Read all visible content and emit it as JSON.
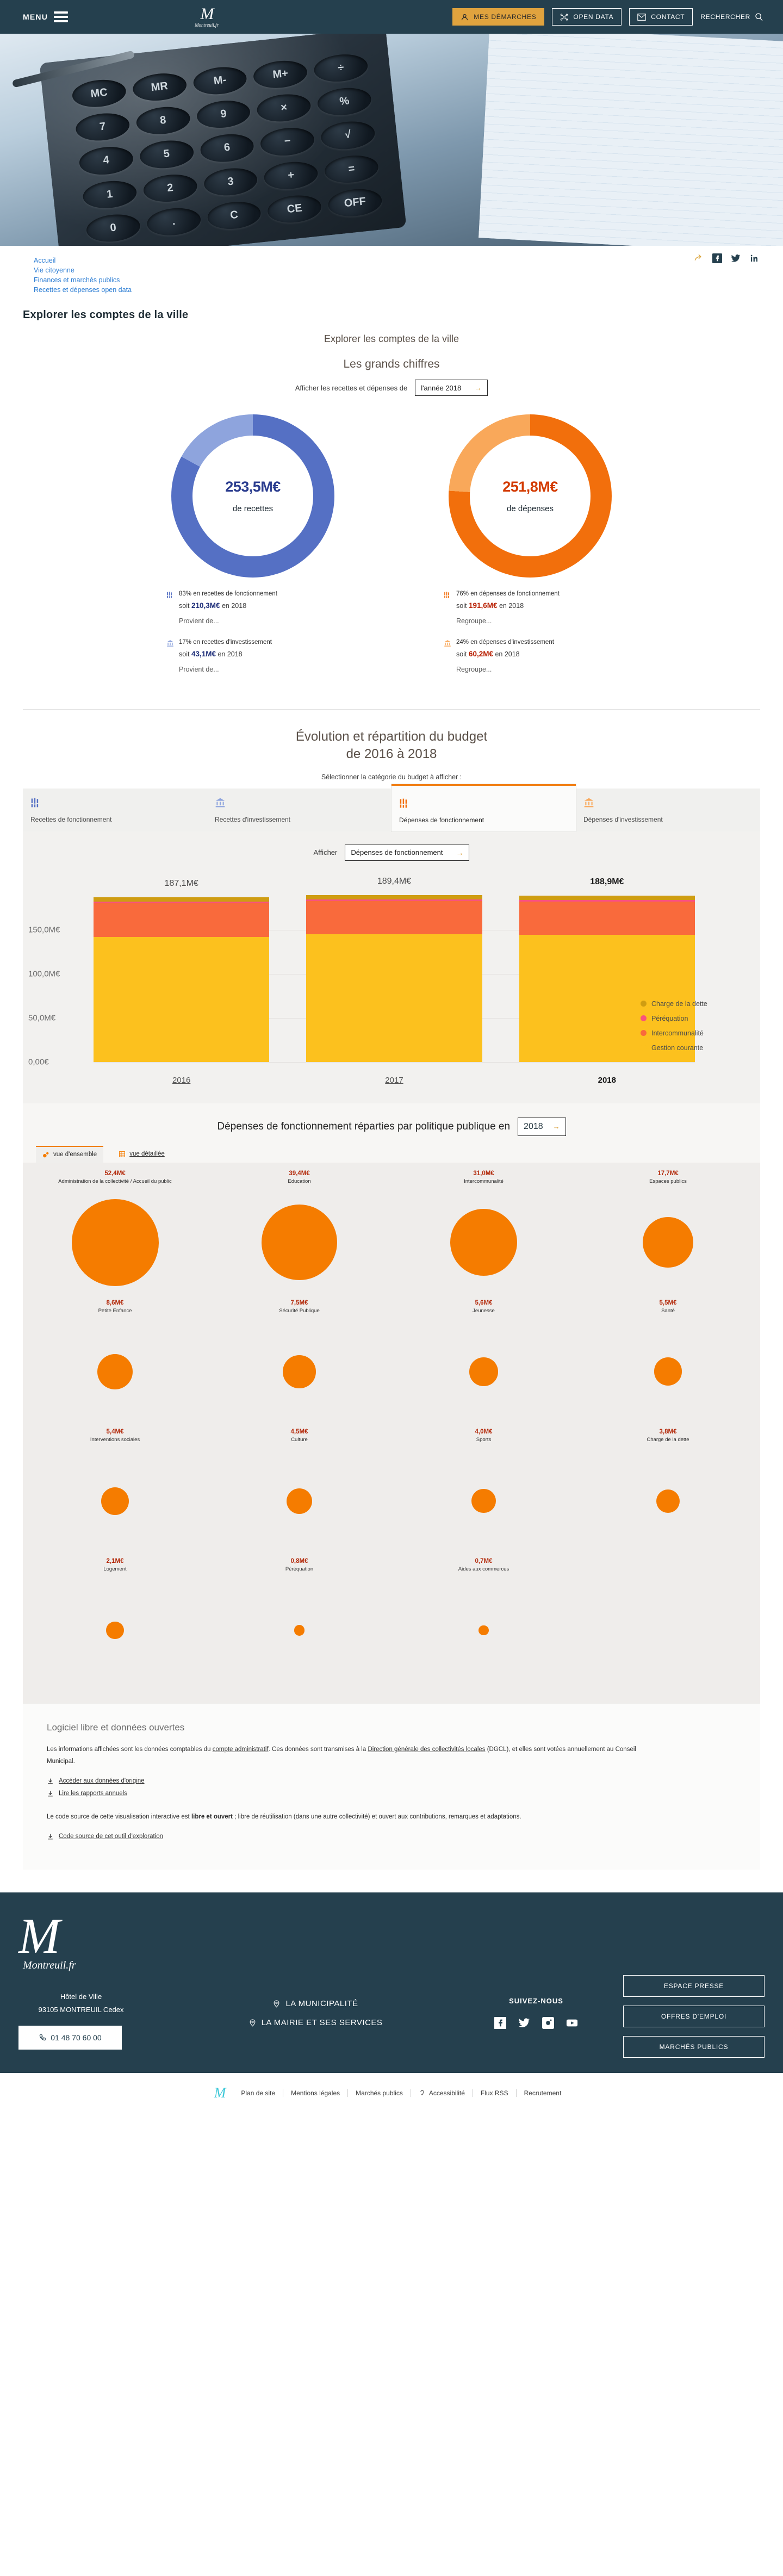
{
  "header": {
    "menu_label": "MENU",
    "logo_mark": "M",
    "logo_sub": "Montreuil.fr",
    "nav": [
      {
        "label": "MES DÉMARCHES",
        "icon": "user-icon",
        "style": "primary"
      },
      {
        "label": "OPEN DATA",
        "icon": "opendata-icon",
        "style": "outline"
      },
      {
        "label": "CONTACT",
        "icon": "envelope-icon",
        "style": "outline"
      }
    ],
    "search_label": "RECHERCHER"
  },
  "breadcrumb": {
    "items": [
      "Accueil",
      "Vie citoyenne",
      "Finances et marchés publics",
      "Recettes et dépenses open data"
    ],
    "share_icons": [
      "share-icon",
      "facebook-icon",
      "twitter-icon",
      "linkedin-icon"
    ]
  },
  "page_title": "Explorer les comptes de la ville",
  "app": {
    "heading": "Explorer les comptes de la ville",
    "subheading": "Les grands chiffres",
    "year_selector_label": "Afficher les recettes et dépenses de",
    "year_selector_value": "l'année 2018",
    "year_selector_arrow": "→"
  },
  "chart_data": [
    {
      "type": "pie",
      "title": "Recettes 2018",
      "center_value": "253,5M€",
      "center_caption": "de recettes",
      "accent": "#5570c4",
      "slices": [
        {
          "label": "Recettes de fonctionnement",
          "percent": 83,
          "value_label": "210,3M€",
          "color": "#5570c4"
        },
        {
          "label": "Recettes d'investissement",
          "percent": 17,
          "value_label": "43,1M€",
          "color": "#8ea4dd"
        }
      ]
    },
    {
      "type": "pie",
      "title": "Dépenses 2018",
      "center_value": "251,8M€",
      "center_caption": "de dépenses",
      "accent": "#f26f0c",
      "slices": [
        {
          "label": "Dépenses de fonctionnement",
          "percent": 76,
          "value_label": "191,6M€",
          "color": "#f26f0c"
        },
        {
          "label": "Dépenses d'investissement",
          "percent": 24,
          "value_label": "60,2M€",
          "color": "#f9a85a"
        }
      ]
    },
    {
      "type": "bar",
      "stacked": true,
      "title": "Dépenses de fonctionnement",
      "categories": [
        "2016",
        "2017",
        "2018"
      ],
      "totals": [
        "187,1M€",
        "189,4M€",
        "188,9M€"
      ],
      "total_values": [
        187.1,
        189.4,
        188.9
      ],
      "ylim": [
        0,
        200
      ],
      "yticks": [
        "0,00€",
        "50,0M€",
        "100,0M€",
        "150,0M€"
      ],
      "ytick_values": [
        0,
        50,
        100,
        150
      ],
      "grid": true,
      "legend_position": "right",
      "series": [
        {
          "name": "Gestion courante",
          "color": "#fcc11e",
          "values": [
            142.0,
            145.2,
            144.6
          ]
        },
        {
          "name": "Intercommunalité",
          "color": "#f96a3c",
          "values": [
            38.0,
            37.5,
            37.2
          ]
        },
        {
          "name": "Péréquation",
          "color": "#f9527d",
          "values": [
            1.9,
            1.9,
            1.9
          ]
        },
        {
          "name": "Charge de la dette",
          "color": "#cf9d12",
          "values": [
            5.2,
            4.8,
            5.2
          ]
        }
      ]
    },
    {
      "type": "scatter",
      "title": "Dépenses de fonctionnement réparties par politique publique en 2018",
      "unit": "M€",
      "color": "#f57c00",
      "bubbles": [
        {
          "label": "Administration de la collectivité / Accueil du public",
          "value_label": "52,4M€",
          "value": 52.4
        },
        {
          "label": "Education",
          "value_label": "39,4M€",
          "value": 39.4
        },
        {
          "label": "Intercommunalité",
          "value_label": "31,0M€",
          "value": 31.0
        },
        {
          "label": "Espaces publics",
          "value_label": "17,7M€",
          "value": 17.7
        },
        {
          "label": "Petite Enfance",
          "value_label": "8,6M€",
          "value": 8.6
        },
        {
          "label": "Sécurité Publique",
          "value_label": "7,5M€",
          "value": 7.5
        },
        {
          "label": "Jeunesse",
          "value_label": "5,6M€",
          "value": 5.6
        },
        {
          "label": "Santé",
          "value_label": "5,5M€",
          "value": 5.5
        },
        {
          "label": "Interventions sociales",
          "value_label": "5,4M€",
          "value": 5.4
        },
        {
          "label": "Culture",
          "value_label": "4,5M€",
          "value": 4.5
        },
        {
          "label": "Sports",
          "value_label": "4,0M€",
          "value": 4.0
        },
        {
          "label": "Charge de la dette",
          "value_label": "3,8M€",
          "value": 3.8
        },
        {
          "label": "Logement",
          "value_label": "2,1M€",
          "value": 2.1
        },
        {
          "label": "Péréquation",
          "value_label": "0,8M€",
          "value": 0.8
        },
        {
          "label": "Aides aux commerces",
          "value_label": "0,7M€",
          "value": 0.7
        }
      ]
    }
  ],
  "recettes_panel": {
    "items": [
      {
        "icon": "bars-icon",
        "headline": "83% en recettes de fonctionnement",
        "sub_prefix": "soit ",
        "sub_value": "210,3M€",
        "sub_suffix": " en 2018",
        "more": "Provient de..."
      },
      {
        "icon": "bank-icon",
        "headline": "17% en recettes d'investissement",
        "sub_prefix": "soit ",
        "sub_value": "43,1M€",
        "sub_suffix": " en 2018",
        "more": "Provient de..."
      }
    ]
  },
  "depenses_panel": {
    "items": [
      {
        "icon": "bars-icon",
        "headline": "76% en dépenses de fonctionnement",
        "sub_prefix": "soit ",
        "sub_value": "191,6M€",
        "sub_suffix": " en 2018",
        "more": "Regroupe..."
      },
      {
        "icon": "bank-icon",
        "headline": "24% en dépenses d'investissement",
        "sub_prefix": "soit ",
        "sub_value": "60,2M€",
        "sub_suffix": " en 2018",
        "more": "Regroupe..."
      }
    ]
  },
  "evolution": {
    "title_line1": "Évolution et répartition du budget",
    "title_line2": "de 2016 à 2018",
    "subtitle": "Sélectionner la catégorie du budget à afficher :",
    "tabs": [
      {
        "label": "Recettes de fonctionnement",
        "icon": "bars-icon",
        "color": "#5570c4",
        "active": false
      },
      {
        "label": "Recettes d'investissement",
        "icon": "bank-icon",
        "color": "#8ea4dd",
        "active": false
      },
      {
        "label": "Dépenses de fonctionnement",
        "icon": "bars-icon",
        "color": "#f26f0c",
        "active": true
      },
      {
        "label": "Dépenses d'investissement",
        "icon": "bank-icon",
        "color": "#f9a85a",
        "active": false
      }
    ],
    "afficher_label": "Afficher",
    "afficher_value": "Dépenses de fonctionnement",
    "afficher_arrow": "→"
  },
  "bubble_section": {
    "heading": "Dépenses de fonctionnement réparties par politique publique en",
    "year": "2018",
    "year_arrow": "→",
    "tabs": [
      {
        "label": "vue d'ensemble",
        "icon": "bubbles-icon",
        "active": true
      },
      {
        "label": "vue détaillée",
        "icon": "table-icon",
        "active": false
      }
    ]
  },
  "libre": {
    "title": "Logiciel libre et données ouvertes",
    "paragraph1_a": "Les informations affichées sont les données comptables du ",
    "paragraph1_link1": "compte administratif",
    "paragraph1_b": ". Ces données sont transmises à la ",
    "paragraph1_link2": "Direction générale des collectivités locales",
    "paragraph1_c": " (DGCL), et elles sont votées annuellement au Conseil Municipal.",
    "links": [
      {
        "label": "Accéder aux données d'origine",
        "icon": "download-icon"
      },
      {
        "label": "Lire les rapports annuels",
        "icon": "download-icon"
      }
    ],
    "paragraph2_a": "Le code source de cette visualisation interactive est ",
    "paragraph2_bold": "libre et ouvert",
    "paragraph2_b": " ; libre de réutilisation (dans une autre collectivité) et ouvert aux contributions, remarques et adaptations.",
    "links2": [
      {
        "label": "Code source de cet outil d'exploration",
        "icon": "download-icon"
      }
    ]
  },
  "footer": {
    "logo_mark": "M",
    "logo_sub": "Montreuil.fr",
    "address_line1": "Hôtel de Ville",
    "address_line2": "93105 MONTREUIL Cedex",
    "phone": "01 48 70 60 00",
    "nav": [
      {
        "label": "LA MUNICIPALITÉ",
        "icon": "pin-icon"
      },
      {
        "label": "LA MAIRIE ET SES SERVICES",
        "icon": "pin-icon"
      }
    ],
    "social_title": "SUIVEZ-NOUS",
    "social": [
      "facebook-icon",
      "twitter-icon",
      "instagram-icon",
      "youtube-icon"
    ],
    "buttons": [
      "ESPACE PRESSE",
      "OFFRES D'EMPLOI",
      "MARCHÉS PUBLICS"
    ],
    "bottom_links": [
      {
        "label": "Plan de site",
        "icon": null
      },
      {
        "label": "Mentions légales",
        "icon": null
      },
      {
        "label": "Marchés publics",
        "icon": null
      },
      {
        "label": "Accessibilité",
        "icon": "ear-icon"
      },
      {
        "label": "Flux RSS",
        "icon": null
      },
      {
        "label": "Recrutement",
        "icon": null
      }
    ]
  }
}
